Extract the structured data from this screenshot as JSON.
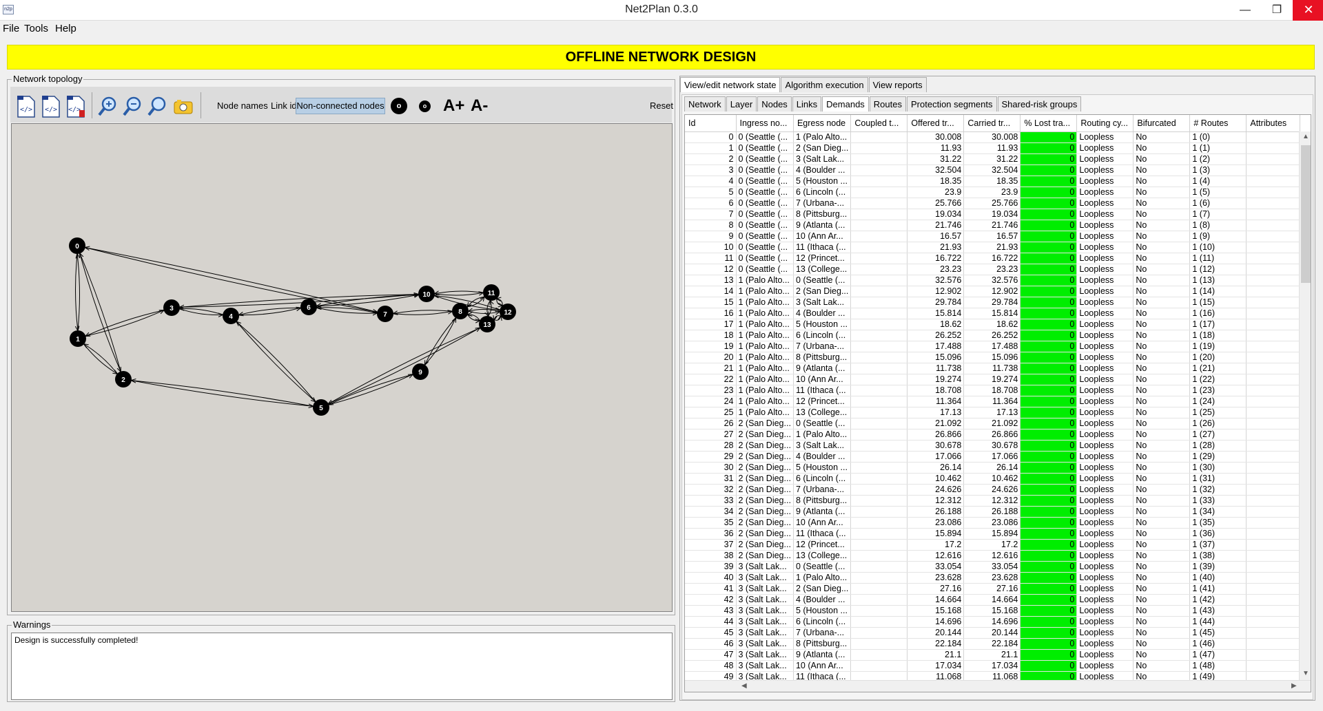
{
  "window": {
    "title": "Net2Plan 0.3.0",
    "icon": "n2p"
  },
  "menu": [
    "File",
    "Tools",
    "Help"
  ],
  "banner": "OFFLINE NETWORK DESIGN",
  "topology": {
    "group_title": "Network topology",
    "toolbar": {
      "icons": [
        "load-design-icon",
        "load-demands-icon",
        "save-design-icon",
        "zoom-in-icon",
        "zoom-out-icon",
        "zoom-all-icon",
        "screenshot-icon"
      ],
      "node_names": "Node names",
      "link_ids": "Link ids",
      "non_connected": "Non-connected nodes",
      "node_size_up": "o",
      "node_size_down": "o",
      "font_larger": "A+",
      "font_smaller": "A-",
      "reset": "Reset"
    },
    "nodes": [
      {
        "id": "0"
      },
      {
        "id": "1"
      },
      {
        "id": "2"
      },
      {
        "id": "3"
      },
      {
        "id": "4"
      },
      {
        "id": "5"
      },
      {
        "id": "6"
      },
      {
        "id": "7"
      },
      {
        "id": "8"
      },
      {
        "id": "9"
      },
      {
        "id": "10"
      },
      {
        "id": "11"
      },
      {
        "id": "12"
      },
      {
        "id": "13"
      }
    ],
    "links": [
      [
        0,
        1
      ],
      [
        0,
        2
      ],
      [
        1,
        2
      ],
      [
        1,
        3
      ],
      [
        0,
        7
      ],
      [
        3,
        4
      ],
      [
        3,
        10
      ],
      [
        4,
        6
      ],
      [
        4,
        5
      ],
      [
        6,
        7
      ],
      [
        2,
        5
      ],
      [
        5,
        9
      ],
      [
        5,
        13
      ],
      [
        9,
        8
      ],
      [
        7,
        8
      ],
      [
        6,
        10
      ],
      [
        10,
        11
      ],
      [
        10,
        12
      ],
      [
        8,
        11
      ],
      [
        8,
        12
      ],
      [
        8,
        13
      ],
      [
        11,
        12
      ],
      [
        11,
        13
      ],
      [
        12,
        13
      ]
    ]
  },
  "warnings": {
    "title": "Warnings",
    "text": "Design is successfully completed!"
  },
  "tabs": {
    "main": [
      "View/edit network state",
      "Algorithm execution",
      "View reports"
    ],
    "main_active": 0,
    "sub": [
      "Network",
      "Layer",
      "Nodes",
      "Links",
      "Demands",
      "Routes",
      "Protection segments",
      "Shared-risk groups"
    ],
    "sub_active": 4
  },
  "table": {
    "columns": [
      "Id",
      "Ingress no...",
      "Egress node",
      "Coupled t...",
      "Offered tr...",
      "Carried tr...",
      "% Lost tra...",
      "Routing cy...",
      "Bifurcated",
      "# Routes",
      "Attributes"
    ],
    "routing": "Loopless",
    "bifurcated": "No",
    "lost": "0",
    "rows": [
      [
        "0",
        "0 (Seattle (...",
        "1 (Palo Alto...",
        "30.008",
        "1 (0)"
      ],
      [
        "1",
        "0 (Seattle (...",
        "2 (San Dieg...",
        "11.93",
        "1 (1)"
      ],
      [
        "2",
        "0 (Seattle (...",
        "3 (Salt Lak...",
        "31.22",
        "1 (2)"
      ],
      [
        "3",
        "0 (Seattle (...",
        "4 (Boulder ...",
        "32.504",
        "1 (3)"
      ],
      [
        "4",
        "0 (Seattle (...",
        "5 (Houston ...",
        "18.35",
        "1 (4)"
      ],
      [
        "5",
        "0 (Seattle (...",
        "6 (Lincoln (...",
        "23.9",
        "1 (5)"
      ],
      [
        "6",
        "0 (Seattle (...",
        "7 (Urbana-...",
        "25.766",
        "1 (6)"
      ],
      [
        "7",
        "0 (Seattle (...",
        "8 (Pittsburg...",
        "19.034",
        "1 (7)"
      ],
      [
        "8",
        "0 (Seattle (...",
        "9 (Atlanta (...",
        "21.746",
        "1 (8)"
      ],
      [
        "9",
        "0 (Seattle (...",
        "10 (Ann Ar...",
        "16.57",
        "1 (9)"
      ],
      [
        "10",
        "0 (Seattle (...",
        "11 (Ithaca (...",
        "21.93",
        "1 (10)"
      ],
      [
        "11",
        "0 (Seattle (...",
        "12 (Princet...",
        "16.722",
        "1 (11)"
      ],
      [
        "12",
        "0 (Seattle (...",
        "13 (College...",
        "23.23",
        "1 (12)"
      ],
      [
        "13",
        "1 (Palo Alto...",
        "0 (Seattle (...",
        "32.576",
        "1 (13)"
      ],
      [
        "14",
        "1 (Palo Alto...",
        "2 (San Dieg...",
        "12.902",
        "1 (14)"
      ],
      [
        "15",
        "1 (Palo Alto...",
        "3 (Salt Lak...",
        "29.784",
        "1 (15)"
      ],
      [
        "16",
        "1 (Palo Alto...",
        "4 (Boulder ...",
        "15.814",
        "1 (16)"
      ],
      [
        "17",
        "1 (Palo Alto...",
        "5 (Houston ...",
        "18.62",
        "1 (17)"
      ],
      [
        "18",
        "1 (Palo Alto...",
        "6 (Lincoln (...",
        "26.252",
        "1 (18)"
      ],
      [
        "19",
        "1 (Palo Alto...",
        "7 (Urbana-...",
        "17.488",
        "1 (19)"
      ],
      [
        "20",
        "1 (Palo Alto...",
        "8 (Pittsburg...",
        "15.096",
        "1 (20)"
      ],
      [
        "21",
        "1 (Palo Alto...",
        "9 (Atlanta (...",
        "11.738",
        "1 (21)"
      ],
      [
        "22",
        "1 (Palo Alto...",
        "10 (Ann Ar...",
        "19.274",
        "1 (22)"
      ],
      [
        "23",
        "1 (Palo Alto...",
        "11 (Ithaca (...",
        "18.708",
        "1 (23)"
      ],
      [
        "24",
        "1 (Palo Alto...",
        "12 (Princet...",
        "11.364",
        "1 (24)"
      ],
      [
        "25",
        "1 (Palo Alto...",
        "13 (College...",
        "17.13",
        "1 (25)"
      ],
      [
        "26",
        "2 (San Dieg...",
        "0 (Seattle (...",
        "21.092",
        "1 (26)"
      ],
      [
        "27",
        "2 (San Dieg...",
        "1 (Palo Alto...",
        "26.866",
        "1 (27)"
      ],
      [
        "28",
        "2 (San Dieg...",
        "3 (Salt Lak...",
        "30.678",
        "1 (28)"
      ],
      [
        "29",
        "2 (San Dieg...",
        "4 (Boulder ...",
        "17.066",
        "1 (29)"
      ],
      [
        "30",
        "2 (San Dieg...",
        "5 (Houston ...",
        "26.14",
        "1 (30)"
      ],
      [
        "31",
        "2 (San Dieg...",
        "6 (Lincoln (...",
        "10.462",
        "1 (31)"
      ],
      [
        "32",
        "2 (San Dieg...",
        "7 (Urbana-...",
        "24.626",
        "1 (32)"
      ],
      [
        "33",
        "2 (San Dieg...",
        "8 (Pittsburg...",
        "12.312",
        "1 (33)"
      ],
      [
        "34",
        "2 (San Dieg...",
        "9 (Atlanta (...",
        "26.188",
        "1 (34)"
      ],
      [
        "35",
        "2 (San Dieg...",
        "10 (Ann Ar...",
        "23.086",
        "1 (35)"
      ],
      [
        "36",
        "2 (San Dieg...",
        "11 (Ithaca (...",
        "15.894",
        "1 (36)"
      ],
      [
        "37",
        "2 (San Dieg...",
        "12 (Princet...",
        "17.2",
        "1 (37)"
      ],
      [
        "38",
        "2 (San Dieg...",
        "13 (College...",
        "12.616",
        "1 (38)"
      ],
      [
        "39",
        "3 (Salt Lak...",
        "0 (Seattle (...",
        "33.054",
        "1 (39)"
      ],
      [
        "40",
        "3 (Salt Lak...",
        "1 (Palo Alto...",
        "23.628",
        "1 (40)"
      ],
      [
        "41",
        "3 (Salt Lak...",
        "2 (San Dieg...",
        "27.16",
        "1 (41)"
      ],
      [
        "42",
        "3 (Salt Lak...",
        "4 (Boulder ...",
        "14.664",
        "1 (42)"
      ],
      [
        "43",
        "3 (Salt Lak...",
        "5 (Houston ...",
        "15.168",
        "1 (43)"
      ],
      [
        "44",
        "3 (Salt Lak...",
        "6 (Lincoln (...",
        "14.696",
        "1 (44)"
      ],
      [
        "45",
        "3 (Salt Lak...",
        "7 (Urbana-...",
        "20.144",
        "1 (45)"
      ],
      [
        "46",
        "3 (Salt Lak...",
        "8 (Pittsburg...",
        "22.184",
        "1 (46)"
      ],
      [
        "47",
        "3 (Salt Lak...",
        "9 (Atlanta (...",
        "21.1",
        "1 (47)"
      ],
      [
        "48",
        "3 (Salt Lak...",
        "10 (Ann Ar...",
        "17.034",
        "1 (48)"
      ],
      [
        "49",
        "3 (Salt Lak...",
        "11 (Ithaca (...",
        "11.068",
        "1 (49)"
      ]
    ]
  }
}
